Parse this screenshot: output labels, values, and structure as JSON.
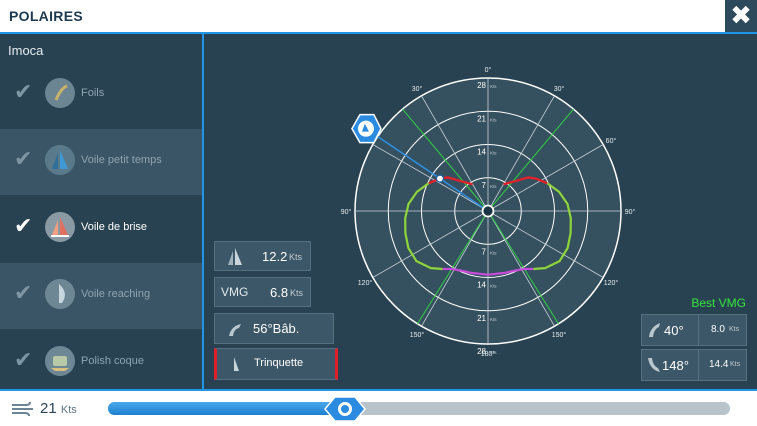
{
  "header": {
    "title": "POLAIRES",
    "close_glyph": "✖"
  },
  "sidebar": {
    "boat_name": "Imoca",
    "items": [
      {
        "label": "Foils",
        "icon": "foils-icon",
        "selected": false
      },
      {
        "label": "Voile petit temps",
        "icon": "light-sail-icon",
        "selected": false
      },
      {
        "label": "Voile de brise",
        "icon": "heavy-sail-icon",
        "selected": true
      },
      {
        "label": "Voile reaching",
        "icon": "reaching-sail-icon",
        "selected": false
      },
      {
        "label": "Polish coque",
        "icon": "hull-polish-icon",
        "selected": false
      }
    ]
  },
  "stats": {
    "boat_speed": {
      "value": "12.2",
      "unit": "Kts"
    },
    "vmg": {
      "label": "VMG",
      "value": "6.8",
      "unit": "Kts"
    },
    "twa": {
      "value": "56°Bâb."
    },
    "sail": {
      "label": "Trinquette"
    }
  },
  "best_vmg": {
    "title": "Best VMG",
    "upwind": {
      "angle": "40°",
      "speed": "8.0",
      "unit": "Kts"
    },
    "downwind": {
      "angle": "148°",
      "speed": "14.4",
      "unit": "Kts"
    }
  },
  "polar": {
    "angle_labels": [
      "0°",
      "30°",
      "60°",
      "90°",
      "120°",
      "150°",
      "180°",
      "150°",
      "120°",
      "90°",
      "60°",
      "30°"
    ],
    "ring_labels": [
      "7",
      "14",
      "21",
      "28"
    ],
    "ring_unit": "Kts",
    "max_speed": 28,
    "cursor_angle": -56,
    "cursor_speed": 12.2,
    "best_vmg_angles": [
      40,
      148
    ],
    "curve": [
      {
        "twa": 30,
        "speed": 6.5
      },
      {
        "twa": 40,
        "speed": 8.0
      },
      {
        "twa": 50,
        "speed": 11.0
      },
      {
        "twa": 56,
        "speed": 12.2
      },
      {
        "twa": 65,
        "speed": 13.8
      },
      {
        "twa": 75,
        "speed": 15.5
      },
      {
        "twa": 85,
        "speed": 16.8
      },
      {
        "twa": 95,
        "speed": 17.5
      },
      {
        "twa": 105,
        "speed": 18.0
      },
      {
        "twa": 115,
        "speed": 18.5
      },
      {
        "twa": 125,
        "speed": 18.4
      },
      {
        "twa": 135,
        "speed": 17.0
      },
      {
        "twa": 142,
        "speed": 15.5
      },
      {
        "twa": 148,
        "speed": 14.4
      },
      {
        "twa": 155,
        "speed": 13.8
      },
      {
        "twa": 165,
        "speed": 13.5
      },
      {
        "twa": 180,
        "speed": 13.4
      }
    ],
    "colors": {
      "upwind": "#e8202a",
      "reach": "#8fd43a",
      "downwind": "#c84ad8",
      "vmg_line": "#2fd040",
      "cursor": "#2f8fe0"
    }
  },
  "wind": {
    "value": "21",
    "unit": "Kts",
    "slider_fraction": 0.38
  }
}
